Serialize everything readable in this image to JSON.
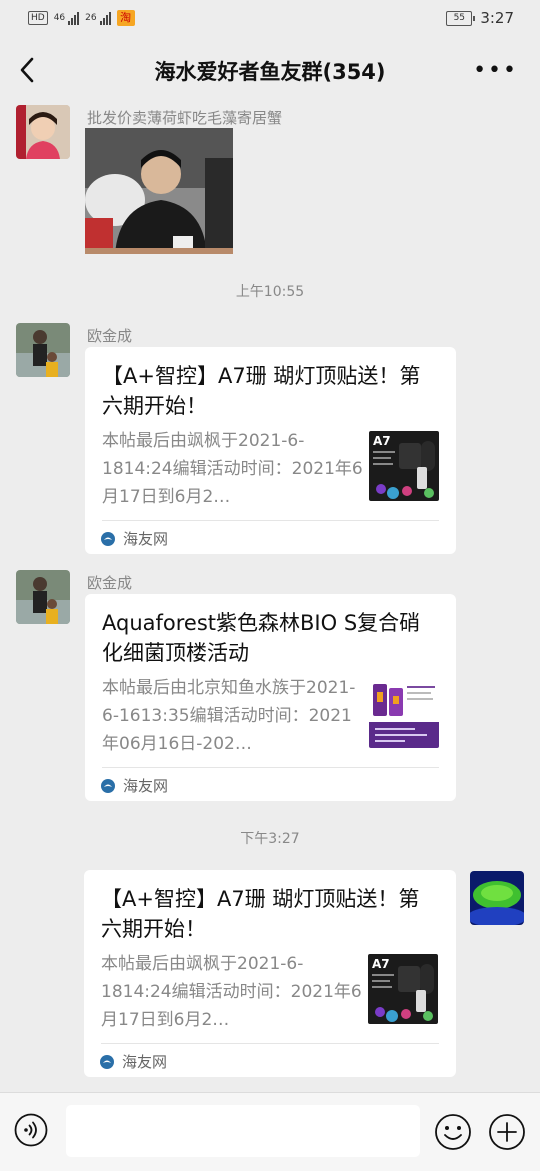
{
  "status_bar": {
    "left_chips": [
      "HD",
      "46",
      "26"
    ],
    "time": "3:27",
    "battery": "55"
  },
  "header": {
    "title": "海水爱好者鱼友群(354)",
    "more": "•••"
  },
  "messages": [
    {
      "sender": "批发价卖薄荷虾吃毛藻寄居蟹",
      "type": "image"
    },
    {
      "timestamp": "上午10:55"
    },
    {
      "sender": "欧金成",
      "type": "link",
      "title": "【A+智控】A7珊 瑚灯顶贴送！第六期开始！",
      "desc": "本帖最后由飒枫于2021-6-1814:24编辑活动时间：2021年6月17日到6月2…",
      "thumb_label": "A7",
      "source": "海友网"
    },
    {
      "sender": "欧金成",
      "type": "link",
      "title": "Aquaforest紫色森林BIO S复合硝化细菌顶楼活动",
      "desc": "本帖最后由北京知鱼水族于2021-6-1613:35编辑活动时间：2021年06月16日-202…",
      "source": "海友网"
    },
    {
      "timestamp": "下午3:27"
    },
    {
      "sender": "",
      "type": "link",
      "self": true,
      "title": "【A+智控】A7珊 瑚灯顶贴送！第六期开始！",
      "desc": "本帖最后由飒枫于2021-6-1814:24编辑活动时间：2021年6月17日到6月2…",
      "thumb_label": "A7",
      "source": "海友网"
    }
  ],
  "colors": {
    "background": "#ededed",
    "bubble": "#ffffff",
    "secondary_text": "#888888",
    "source_icon": "#2a6fa8"
  }
}
